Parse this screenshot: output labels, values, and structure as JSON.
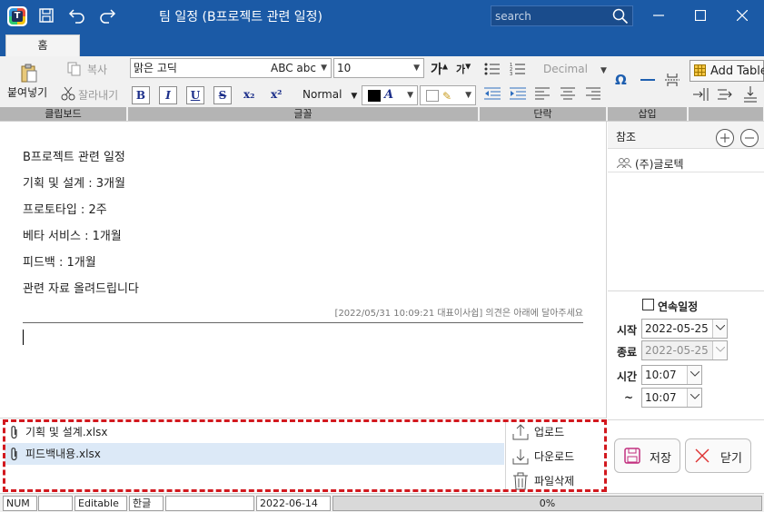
{
  "titlebar": {
    "title": "팀 일정 (B프로젝트 관련 일정)",
    "search_placeholder": "search",
    "app_icon": "T"
  },
  "tabs": [
    {
      "label": "홈",
      "active": true
    }
  ],
  "ribbon": {
    "clipboard": {
      "paste_label": "붙여넣기",
      "copy_label": "복사",
      "cut_label": "잘라내기",
      "group_label": "클립보드"
    },
    "font": {
      "font_name": "맑은 고딕",
      "font_preview": "ABC abc",
      "font_size": "10",
      "style_value": "Normal",
      "group_label": "글꼴",
      "bold": "B",
      "italic": "I",
      "underline": "U",
      "strike": "S",
      "subscript": "x₂",
      "superscript": "x²",
      "grow_font": "가",
      "shrink_font": "가"
    },
    "paragraph": {
      "numbering_value": "Decimal",
      "group_label": "단락"
    },
    "insert": {
      "group_label": "삽입"
    },
    "table": {
      "add_table_label": "Add Table"
    }
  },
  "editor": {
    "lines": [
      "B프로젝트 관련 일정",
      "기획 및 설계 : 3개월",
      "프로토타입 : 2주",
      "베타 서비스 : 1개월",
      "피드백 : 1개월",
      "관련 자료 올려드립니다"
    ],
    "comment_meta": "[2022/05/31 10:09:21 대표이사쉽] 의견은 아래에 달아주세요"
  },
  "sidebar": {
    "reference_label": "참조",
    "references": [
      "(주)글로텍"
    ],
    "continuous_label": "연속일정",
    "continuous_checked": false,
    "start_label": "시작",
    "start_date": "2022-05-25",
    "end_label": "종료",
    "end_date": "2022-05-25",
    "time_label": "시간",
    "start_time": "10:07",
    "tilde": "~",
    "end_time": "10:07",
    "save_label": "저장",
    "close_label": "닫기"
  },
  "attachments": {
    "files": [
      {
        "name": "기획 및 설계.xlsx",
        "selected": false
      },
      {
        "name": "피드백내용.xlsx",
        "selected": true
      }
    ],
    "upload_label": "업로드",
    "download_label": "다운로드",
    "delete_label": "파일삭제"
  },
  "statusbar": {
    "num": "NUM",
    "mode": "Editable",
    "ime": "한글",
    "date": "2022-06-14",
    "progress_text": "0%",
    "progress_fraction": 0
  },
  "colors": {
    "titlebar": "#1b5aa6",
    "highlight_border": "#d2181e",
    "selected_row": "#dce9f7",
    "save_icon": "#c2307f",
    "close_icon": "#d33"
  }
}
